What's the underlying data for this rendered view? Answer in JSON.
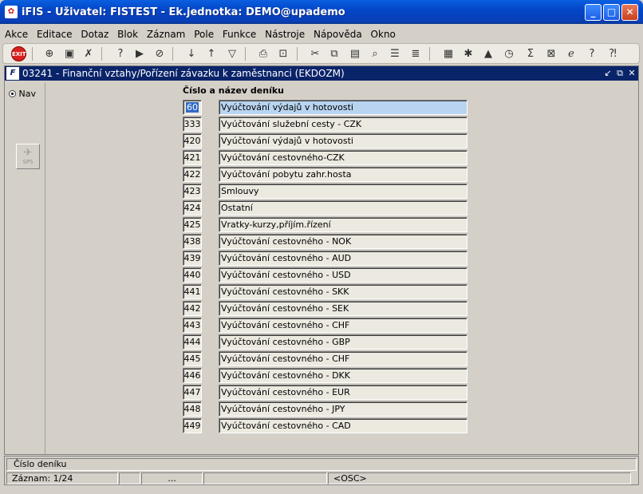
{
  "window": {
    "title": "iFIS - Uživatel: FISTEST - Ek.jednotka: DEMO@upademo",
    "minimize_label": "_",
    "maximize_label": "□",
    "close_label": "✕"
  },
  "menu": [
    "Akce",
    "Editace",
    "Dotaz",
    "Blok",
    "Záznam",
    "Pole",
    "Funkce",
    "Nástroje",
    "Nápověda",
    "Okno"
  ],
  "toolbar": {
    "exit_label": "EXIT",
    "icons": [
      "insert-record-icon",
      "save-icon",
      "delete-record-icon",
      "enter-query-icon",
      "execute-query-icon",
      "cancel-query-icon",
      "sort-asc-icon",
      "sort-desc-icon",
      "filter-icon",
      "print-icon",
      "print-preview-icon",
      "cut-icon",
      "copy-icon",
      "paste-icon",
      "find-icon",
      "list-icon",
      "list-values-icon",
      "calculator-icon",
      "settings-icon",
      "triangle-icon",
      "clock-icon",
      "sum-icon",
      "excel-icon",
      "ie-icon",
      "help-icon",
      "context-help-icon"
    ]
  },
  "form": {
    "title": "03241 - Finanční vztahy/Pořízení závazku k zaměstnanci (EKDOZM)",
    "nav_label": "Nav",
    "sps_label": "SPS",
    "column_header": "Číslo a název deníku",
    "rows": [
      {
        "num": "60",
        "name": "Vyúčtování výdajů v hotovosti",
        "active": true
      },
      {
        "num": "333",
        "name": "Vyúčtování služební cesty - CZK"
      },
      {
        "num": "420",
        "name": "Vyúčtování výdajů v hotovosti"
      },
      {
        "num": "421",
        "name": "Vyúčtování cestovného-CZK"
      },
      {
        "num": "422",
        "name": "Vyúčtování pobytu zahr.hosta"
      },
      {
        "num": "423",
        "name": "Smlouvy"
      },
      {
        "num": "424",
        "name": "Ostatní"
      },
      {
        "num": "425",
        "name": "Vratky-kurzy,příjím.řízení"
      },
      {
        "num": "438",
        "name": "Vyúčtování cestovného - NOK"
      },
      {
        "num": "439",
        "name": "Vyúčtování cestovného - AUD"
      },
      {
        "num": "440",
        "name": "Vyúčtování cestovného - USD"
      },
      {
        "num": "441",
        "name": "Vyúčtování cestovného - SKK"
      },
      {
        "num": "442",
        "name": "Vyúčtování cestovného - SEK"
      },
      {
        "num": "443",
        "name": "Vyúčtování cestovného - CHF"
      },
      {
        "num": "444",
        "name": "Vyúčtování cestovného - GBP"
      },
      {
        "num": "445",
        "name": "Vyúčtování cestovného - CHF"
      },
      {
        "num": "446",
        "name": "Vyúčtování cestovného - DKK"
      },
      {
        "num": "447",
        "name": "Vyúčtování cestovného - EUR"
      },
      {
        "num": "448",
        "name": "Vyúčtování cestovného - JPY"
      },
      {
        "num": "449",
        "name": "Vyúčtování cestovného - CAD"
      }
    ]
  },
  "status": {
    "hint": "Číslo deníku",
    "record": "Záznam: 1/24",
    "ellipsis": "...",
    "mode": "<OSC>"
  }
}
